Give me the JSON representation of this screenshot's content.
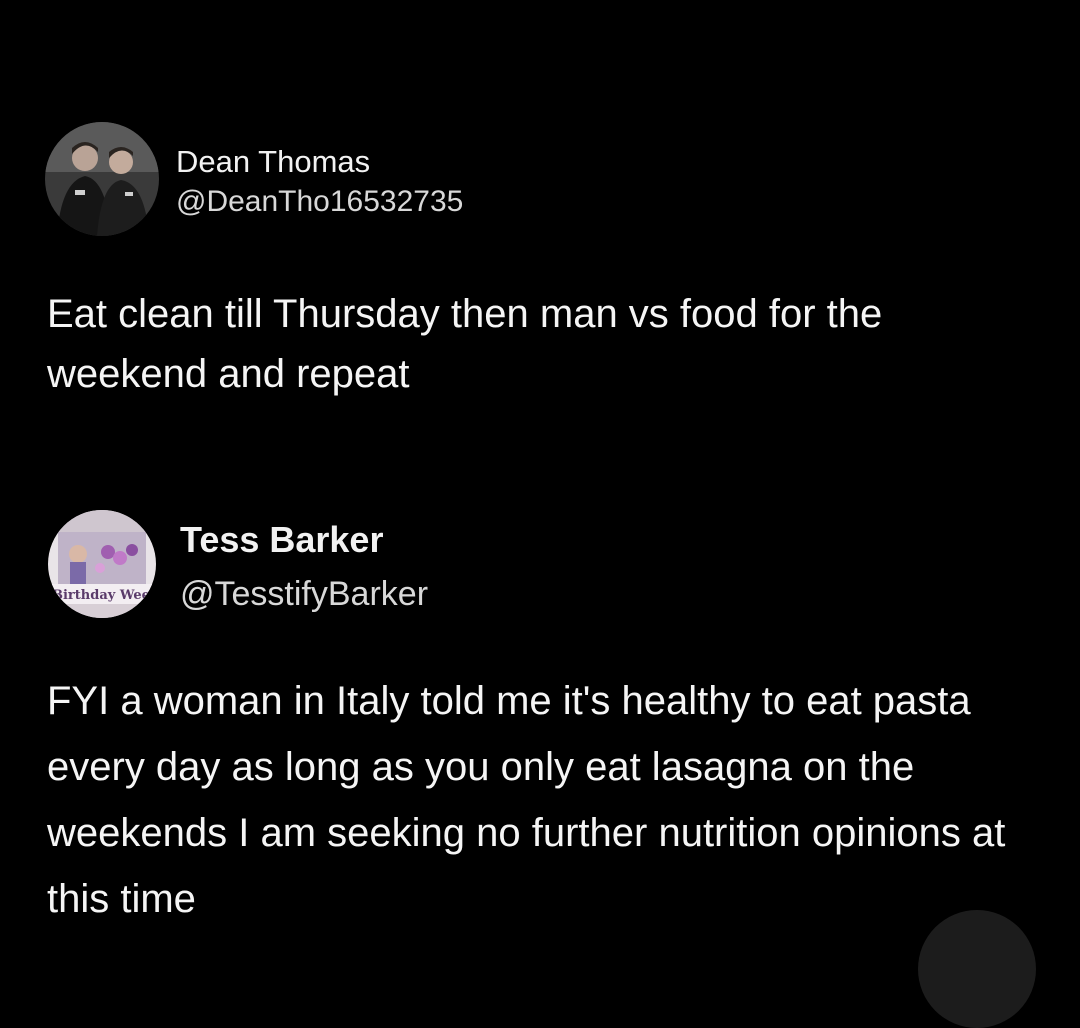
{
  "tweets": [
    {
      "author": {
        "name": "Dean Thomas",
        "handle": "@DeanTho16532735",
        "avatar_icon": "photo-two-men-avatar"
      },
      "text": "Eat clean till Thursday then man vs food for the weekend and repeat"
    },
    {
      "author": {
        "name": "Tess Barker",
        "handle": "@TesstifyBarker",
        "avatar_icon": "photo-birthday-banner-avatar",
        "avatar_caption": "Birthday Wee"
      },
      "text": "FYI a woman in Italy told me it's healthy to eat pasta every day as long as you only eat lasagna on the weekends I am seeking no further nutrition opinions at this time"
    }
  ],
  "colors": {
    "background": "#000000",
    "text": "#f5f5f5",
    "secondary_text": "#d8d8d8",
    "float_button": "#1c1c1c"
  }
}
